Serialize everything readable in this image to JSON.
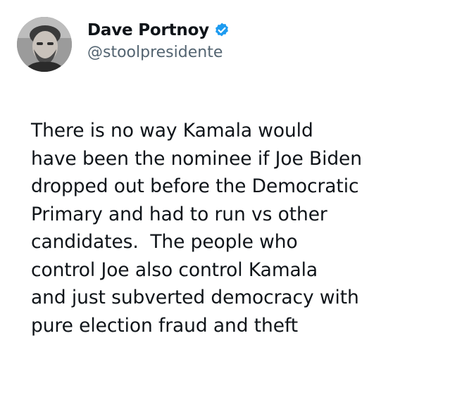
{
  "author": {
    "display_name": "Dave Portnoy",
    "handle": "@stoolpresidente",
    "verified_icon": "verified-badge-icon",
    "verified_color": "#1d9bf0"
  },
  "tweet": {
    "lines": [
      "There is no way Kamala would",
      "have been the nominee if Joe Biden",
      "dropped out before the Democratic",
      "Primary and had to run vs other",
      "candidates.  The people who",
      "control Joe also control Kamala",
      "and just subverted democracy with",
      "pure election fraud and theft"
    ]
  }
}
